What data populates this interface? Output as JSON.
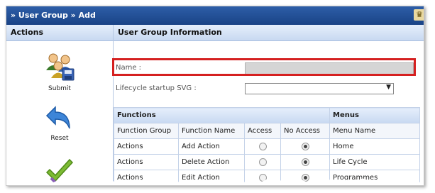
{
  "title": "» User Group » Add",
  "left": {
    "header": "Actions",
    "actions": [
      {
        "label": "Submit",
        "icon": "users-save-icon"
      },
      {
        "label": "Reset",
        "icon": "undo-arrow-icon"
      },
      {
        "label": "",
        "icon": "checkmark-icon"
      }
    ]
  },
  "form": {
    "header": "User Group Information",
    "name_label": "Name :",
    "name_value": "",
    "lifecycle_label": "Lifecycle startup SVG :",
    "lifecycle_value": ""
  },
  "functions": {
    "header": "Functions",
    "columns": [
      "Function Group",
      "Function Name",
      "Access",
      "No Access"
    ],
    "rows": [
      {
        "group": "Actions",
        "name": "Add Action",
        "access": false,
        "no_access": true
      },
      {
        "group": "Actions",
        "name": "Delete Action",
        "access": false,
        "no_access": true
      },
      {
        "group": "Actions",
        "name": "Edit Action",
        "access": false,
        "no_access": true
      }
    ]
  },
  "menus": {
    "header": "Menus",
    "columns": [
      "Menu Name"
    ],
    "rows": [
      "Home",
      "Life Cycle",
      "Programmes"
    ]
  },
  "colors": {
    "titlebar": "#1f4c93",
    "highlight": "#d52020"
  }
}
